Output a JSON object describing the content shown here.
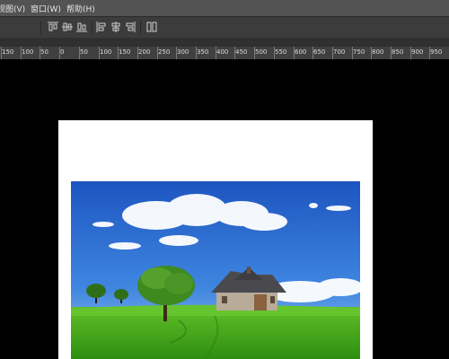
{
  "menu": {
    "view": "视图(V)",
    "window": "窗口(W)",
    "help": "帮助(H)"
  },
  "toolbar_icons": [
    "align-top-icon",
    "align-vcenter-icon",
    "align-bottom-icon",
    "align-left-icon",
    "align-hcenter-icon",
    "align-right-icon",
    "distribute-icon"
  ],
  "ruler": {
    "labels": [
      "150",
      "100",
      "50",
      "0",
      "50",
      "100",
      "150",
      "200",
      "250",
      "300",
      "350",
      "400",
      "450",
      "500",
      "550",
      "600",
      "650",
      "700",
      "750",
      "800",
      "850",
      "900",
      "950"
    ]
  },
  "colors": {
    "menubar": "#535353",
    "canvas": "#000000",
    "document": "#ffffff",
    "sky": "#2f6fd1",
    "grass": "#3fa61a"
  }
}
